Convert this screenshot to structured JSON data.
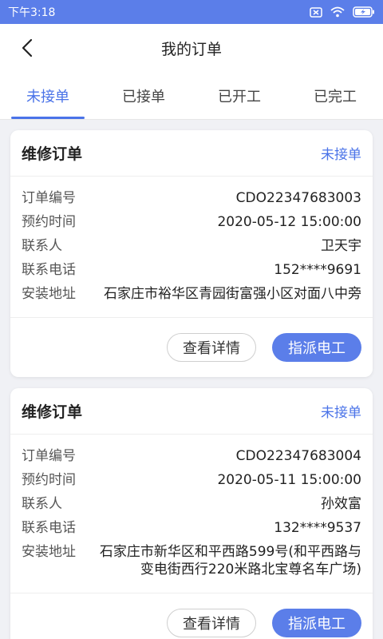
{
  "status_bar": {
    "time": "下午3:18"
  },
  "header": {
    "title": "我的订单"
  },
  "tabs": [
    {
      "label": "未接单"
    },
    {
      "label": "已接单"
    },
    {
      "label": "已开工"
    },
    {
      "label": "已完工"
    }
  ],
  "orders": [
    {
      "title": "维修订单",
      "status": "未接单",
      "fields": [
        {
          "label": "订单编号",
          "value": "CDO22347683003"
        },
        {
          "label": "预约时间",
          "value": "2020-05-12 15:00:00"
        },
        {
          "label": "联系人",
          "value": "卫天宇"
        },
        {
          "label": "联系电话",
          "value": "152****9691"
        },
        {
          "label": "安装地址",
          "value": "石家庄市裕华区青园街富强小区对面八中旁"
        }
      ],
      "btn_detail": "查看详情",
      "btn_assign": "指派电工"
    },
    {
      "title": "维修订单",
      "status": "未接单",
      "fields": [
        {
          "label": "订单编号",
          "value": "CDO22347683004"
        },
        {
          "label": "预约时间",
          "value": "2020-05-11 15:00:00"
        },
        {
          "label": "联系人",
          "value": "孙效富"
        },
        {
          "label": "联系电话",
          "value": "132****9537"
        },
        {
          "label": "安装地址",
          "value": "石家庄市新华区和平西路599号(和平西路与变电街西行220米路北宝尊名车广场)"
        }
      ],
      "btn_detail": "查看详情",
      "btn_assign": "指派电工"
    }
  ]
}
